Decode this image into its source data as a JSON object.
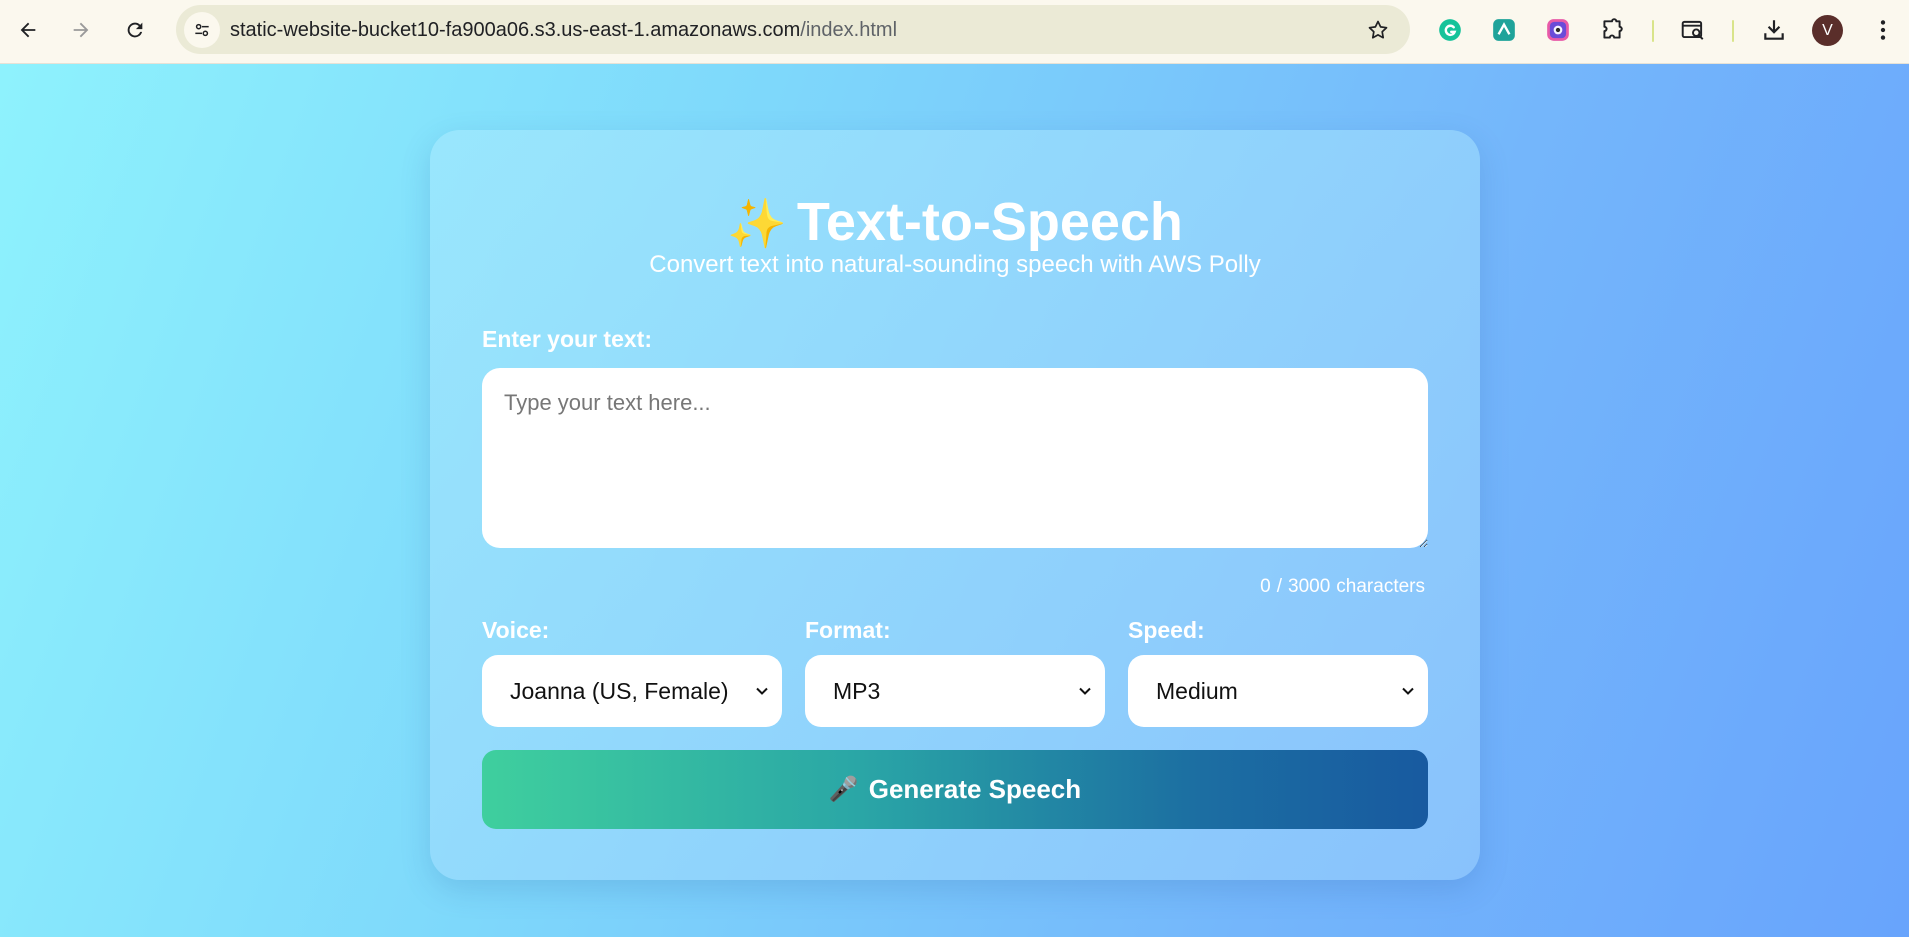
{
  "browser": {
    "url_host": "static-website-bucket10-fa900a06.s3.us-east-1.amazonaws.com",
    "url_path": "/index.html",
    "avatar_letter": "V"
  },
  "app": {
    "title_icon": "✨",
    "title": "Text-to-Speech",
    "subtitle": "Convert text into natural-sounding speech with AWS Polly",
    "text_label": "Enter your text:",
    "text_placeholder": "Type your text here...",
    "text_value": "",
    "char_count": "0",
    "char_separator": "/",
    "char_max": "3000",
    "char_unit": "characters",
    "voice": {
      "label": "Voice:",
      "selected": "Joanna (US, Female)"
    },
    "format": {
      "label": "Format:",
      "selected": "MP3"
    },
    "speed": {
      "label": "Speed:",
      "selected": "Medium"
    },
    "generate_icon": "🎤",
    "generate_label": "Generate Speech"
  },
  "colors": {
    "accent_start": "#3fcf9e",
    "accent_end": "#185aa0",
    "page_gradient_start": "#8ef2fd",
    "page_gradient_end": "#68a4fc"
  },
  "icons": [
    "back-arrow-icon",
    "forward-arrow-icon",
    "reload-icon",
    "site-info-icon",
    "bookmark-star-icon",
    "grammarly-icon",
    "extension-icon-2",
    "extension-icon-3",
    "extensions-puzzle-icon",
    "tab-search-icon",
    "download-icon",
    "kebab-menu-icon",
    "sparkle-icon",
    "microphone-icon",
    "chevron-down-icon"
  ]
}
